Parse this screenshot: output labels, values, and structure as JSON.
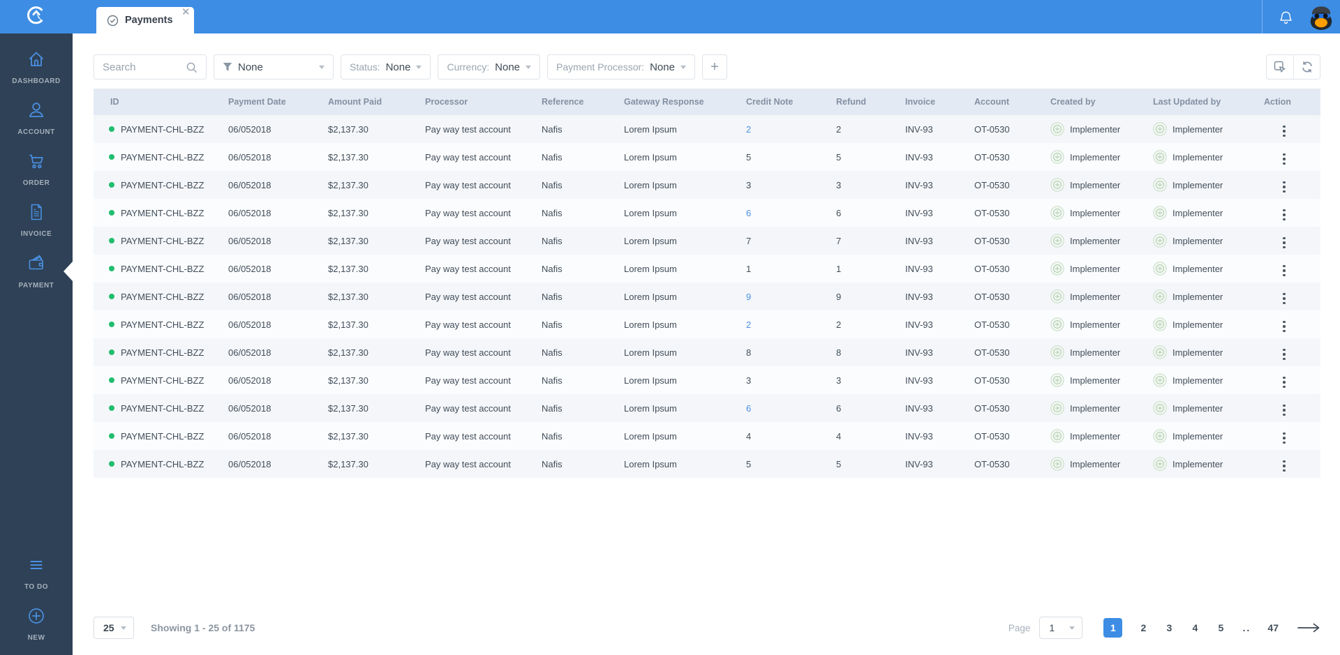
{
  "topbar": {
    "logo_icon": "ca-logo-icon",
    "tab": {
      "icon": "check-circle-icon",
      "label": "Payments",
      "close_icon": "close-icon"
    },
    "bell_icon": "bell-icon",
    "avatar_icon": "penguin-avatar"
  },
  "sidebar": {
    "items": [
      {
        "label": "DASHBOARD",
        "icon": "home-icon",
        "active": false
      },
      {
        "label": "ACCOUNT",
        "icon": "user-icon",
        "active": false
      },
      {
        "label": "ORDER",
        "icon": "cart-icon",
        "active": false
      },
      {
        "label": "INVOICE",
        "icon": "invoice-icon",
        "active": false
      },
      {
        "label": "PAYMENT",
        "icon": "wallet-icon",
        "active": true
      }
    ],
    "bottom_items": [
      {
        "label": "TO DO",
        "icon": "list-icon"
      },
      {
        "label": "NEW",
        "icon": "plus-circle-icon"
      }
    ]
  },
  "filters": {
    "search": {
      "placeholder": "Search",
      "icon": "search-icon"
    },
    "saved_filter": {
      "icon": "funnel-icon",
      "value": "None"
    },
    "status": {
      "label": "Status:",
      "value": "None"
    },
    "currency": {
      "label": "Currency:",
      "value": "None"
    },
    "payment_processor": {
      "label": "Payment Processor:",
      "value": "None"
    },
    "add_filter_label": "+",
    "tools": [
      {
        "icon": "select-cursor-icon"
      },
      {
        "icon": "refresh-icon"
      }
    ]
  },
  "table": {
    "columns": [
      "ID",
      "Payment Date",
      "Amount Paid",
      "Processor",
      "Reference",
      "Gateway Response",
      "Credit Note",
      "Refund",
      "Invoice",
      "Account",
      "Created by",
      "Last Updated by",
      "Action"
    ],
    "rows": [
      {
        "id": "PAYMENT-CHL-BZZ",
        "payment_date": "06/052018",
        "amount_paid": "$2,137.30",
        "processor": "Pay way test account",
        "reference": "Nafis",
        "gateway_response": "Lorem Ipsum",
        "credit_note": "2",
        "credit_note_link": true,
        "refund": "2",
        "invoice": "INV-93",
        "account": "OT-0530",
        "created_by": "Implementer",
        "last_updated_by": "Implementer"
      },
      {
        "id": "PAYMENT-CHL-BZZ",
        "payment_date": "06/052018",
        "amount_paid": "$2,137.30",
        "processor": "Pay way test account",
        "reference": "Nafis",
        "gateway_response": "Lorem Ipsum",
        "credit_note": "5",
        "credit_note_link": false,
        "refund": "5",
        "invoice": "INV-93",
        "account": "OT-0530",
        "created_by": "Implementer",
        "last_updated_by": "Implementer"
      },
      {
        "id": "PAYMENT-CHL-BZZ",
        "payment_date": "06/052018",
        "amount_paid": "$2,137.30",
        "processor": "Pay way test account",
        "reference": "Nafis",
        "gateway_response": "Lorem Ipsum",
        "credit_note": "3",
        "credit_note_link": false,
        "refund": "3",
        "invoice": "INV-93",
        "account": "OT-0530",
        "created_by": "Implementer",
        "last_updated_by": "Implementer"
      },
      {
        "id": "PAYMENT-CHL-BZZ",
        "payment_date": "06/052018",
        "amount_paid": "$2,137.30",
        "processor": "Pay way test account",
        "reference": "Nafis",
        "gateway_response": "Lorem Ipsum",
        "credit_note": "6",
        "credit_note_link": true,
        "refund": "6",
        "invoice": "INV-93",
        "account": "OT-0530",
        "created_by": "Implementer",
        "last_updated_by": "Implementer"
      },
      {
        "id": "PAYMENT-CHL-BZZ",
        "payment_date": "06/052018",
        "amount_paid": "$2,137.30",
        "processor": "Pay way test account",
        "reference": "Nafis",
        "gateway_response": "Lorem Ipsum",
        "credit_note": "7",
        "credit_note_link": false,
        "refund": "7",
        "invoice": "INV-93",
        "account": "OT-0530",
        "created_by": "Implementer",
        "last_updated_by": "Implementer"
      },
      {
        "id": "PAYMENT-CHL-BZZ",
        "payment_date": "06/052018",
        "amount_paid": "$2,137.30",
        "processor": "Pay way test account",
        "reference": "Nafis",
        "gateway_response": "Lorem Ipsum",
        "credit_note": "1",
        "credit_note_link": false,
        "refund": "1",
        "invoice": "INV-93",
        "account": "OT-0530",
        "created_by": "Implementer",
        "last_updated_by": "Implementer"
      },
      {
        "id": "PAYMENT-CHL-BZZ",
        "payment_date": "06/052018",
        "amount_paid": "$2,137.30",
        "processor": "Pay way test account",
        "reference": "Nafis",
        "gateway_response": "Lorem Ipsum",
        "credit_note": "9",
        "credit_note_link": true,
        "refund": "9",
        "invoice": "INV-93",
        "account": "OT-0530",
        "created_by": "Implementer",
        "last_updated_by": "Implementer"
      },
      {
        "id": "PAYMENT-CHL-BZZ",
        "payment_date": "06/052018",
        "amount_paid": "$2,137.30",
        "processor": "Pay way test account",
        "reference": "Nafis",
        "gateway_response": "Lorem Ipsum",
        "credit_note": "2",
        "credit_note_link": true,
        "refund": "2",
        "invoice": "INV-93",
        "account": "OT-0530",
        "created_by": "Implementer",
        "last_updated_by": "Implementer"
      },
      {
        "id": "PAYMENT-CHL-BZZ",
        "payment_date": "06/052018",
        "amount_paid": "$2,137.30",
        "processor": "Pay way test account",
        "reference": "Nafis",
        "gateway_response": "Lorem Ipsum",
        "credit_note": "8",
        "credit_note_link": false,
        "refund": "8",
        "invoice": "INV-93",
        "account": "OT-0530",
        "created_by": "Implementer",
        "last_updated_by": "Implementer"
      },
      {
        "id": "PAYMENT-CHL-BZZ",
        "payment_date": "06/052018",
        "amount_paid": "$2,137.30",
        "processor": "Pay way test account",
        "reference": "Nafis",
        "gateway_response": "Lorem Ipsum",
        "credit_note": "3",
        "credit_note_link": false,
        "refund": "3",
        "invoice": "INV-93",
        "account": "OT-0530",
        "created_by": "Implementer",
        "last_updated_by": "Implementer"
      },
      {
        "id": "PAYMENT-CHL-BZZ",
        "payment_date": "06/052018",
        "amount_paid": "$2,137.30",
        "processor": "Pay way test account",
        "reference": "Nafis",
        "gateway_response": "Lorem Ipsum",
        "credit_note": "6",
        "credit_note_link": true,
        "refund": "6",
        "invoice": "INV-93",
        "account": "OT-0530",
        "created_by": "Implementer",
        "last_updated_by": "Implementer"
      },
      {
        "id": "PAYMENT-CHL-BZZ",
        "payment_date": "06/052018",
        "amount_paid": "$2,137.30",
        "processor": "Pay way test account",
        "reference": "Nafis",
        "gateway_response": "Lorem Ipsum",
        "credit_note": "4",
        "credit_note_link": false,
        "refund": "4",
        "invoice": "INV-93",
        "account": "OT-0530",
        "created_by": "Implementer",
        "last_updated_by": "Implementer"
      },
      {
        "id": "PAYMENT-CHL-BZZ",
        "payment_date": "06/052018",
        "amount_paid": "$2,137.30",
        "processor": "Pay way test account",
        "reference": "Nafis",
        "gateway_response": "Lorem Ipsum",
        "credit_note": "5",
        "credit_note_link": false,
        "refund": "5",
        "invoice": "INV-93",
        "account": "OT-0530",
        "created_by": "Implementer",
        "last_updated_by": "Implementer"
      }
    ]
  },
  "footer": {
    "page_size": "25",
    "showing_text": "Showing 1 - 25 of 1175",
    "page_label": "Page",
    "page_value": "1",
    "pages": [
      {
        "label": "1",
        "active": true
      },
      {
        "label": "2"
      },
      {
        "label": "3"
      },
      {
        "label": "4"
      },
      {
        "label": "5"
      },
      {
        "label": "..",
        "disabled": true
      },
      {
        "label": "47"
      }
    ],
    "next_icon": "arrow-right-icon"
  },
  "colors": {
    "topbar_blue": "#3d8de4",
    "sidebar_navy": "#2e4156",
    "icon_blue": "#4a90e2",
    "link_blue": "#4a90e2",
    "status_green": "#21bd6e",
    "table_header_bg": "#e4eaf3",
    "row_stripe": "#f4f6f9"
  }
}
